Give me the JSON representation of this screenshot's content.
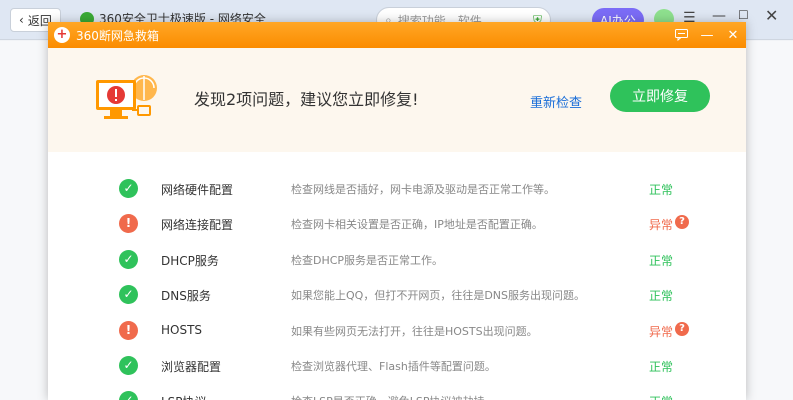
{
  "browser": {
    "back_label": "返回",
    "tab_title": "360安全卫士极速版 - 网络安全",
    "search_placeholder": "搜索功能、软件",
    "ai_label": "AI办公"
  },
  "dialog": {
    "title": "360断网急救箱",
    "headline": "发现2项问题，建议您立即修复!",
    "rescan_label": "重新检查",
    "fix_label": "立即修复"
  },
  "colors": {
    "accent": "#fb8c00",
    "ok": "#2fc25b",
    "error": "#f06a4c",
    "link": "#1a6ed8"
  },
  "checks": [
    {
      "name": "网络硬件配置",
      "desc": "检查网线是否插好，网卡电源及驱动是否正常工作等。",
      "status": "正常",
      "ok": true
    },
    {
      "name": "网络连接配置",
      "desc": "检查网卡相关设置是否正确，IP地址是否配置正确。",
      "status": "异常",
      "ok": false
    },
    {
      "name": "DHCP服务",
      "desc": "检查DHCP服务是否正常工作。",
      "status": "正常",
      "ok": true
    },
    {
      "name": "DNS服务",
      "desc": "如果您能上QQ，但打不开网页，往往是DNS服务出现问题。",
      "status": "正常",
      "ok": true
    },
    {
      "name": "HOSTS",
      "desc": "如果有些网页无法打开，往往是HOSTS出现问题。",
      "status": "异常",
      "ok": false
    },
    {
      "name": "浏览器配置",
      "desc": "检查浏览器代理、Flash插件等配置问题。",
      "status": "正常",
      "ok": true
    },
    {
      "name": "LSP协议",
      "desc": "检查LSP是否正确，避免LSP协议被劫持",
      "status": "正常",
      "ok": true
    }
  ]
}
